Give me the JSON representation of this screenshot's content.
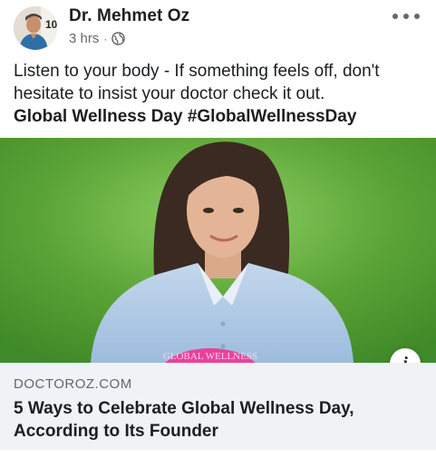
{
  "header": {
    "author": "Dr. Mehmet Oz",
    "avatar_badge": "10",
    "time": "3 hrs",
    "separator": "·",
    "privacy_icon": "globe-icon",
    "more_icon": "more-options-icon"
  },
  "post": {
    "text": "Listen to your body - If something feels off, don't hesitate to insist your doctor check it out.",
    "tags": "Global Wellness Day #GlobalWellnessDay"
  },
  "image": {
    "badge_text": "GLOBAL WELLNESS"
  },
  "link": {
    "domain": "DOCTOROZ.COM",
    "title": "5 Ways to Celebrate Global Wellness Day, According to Its Founder",
    "info_icon_label": "i"
  },
  "colors": {
    "text_primary": "#1c1e21",
    "text_secondary": "#65676b",
    "link_card_bg": "#f0f2f5",
    "grass": "#5aa336",
    "badge_pink": "#e8429a"
  }
}
